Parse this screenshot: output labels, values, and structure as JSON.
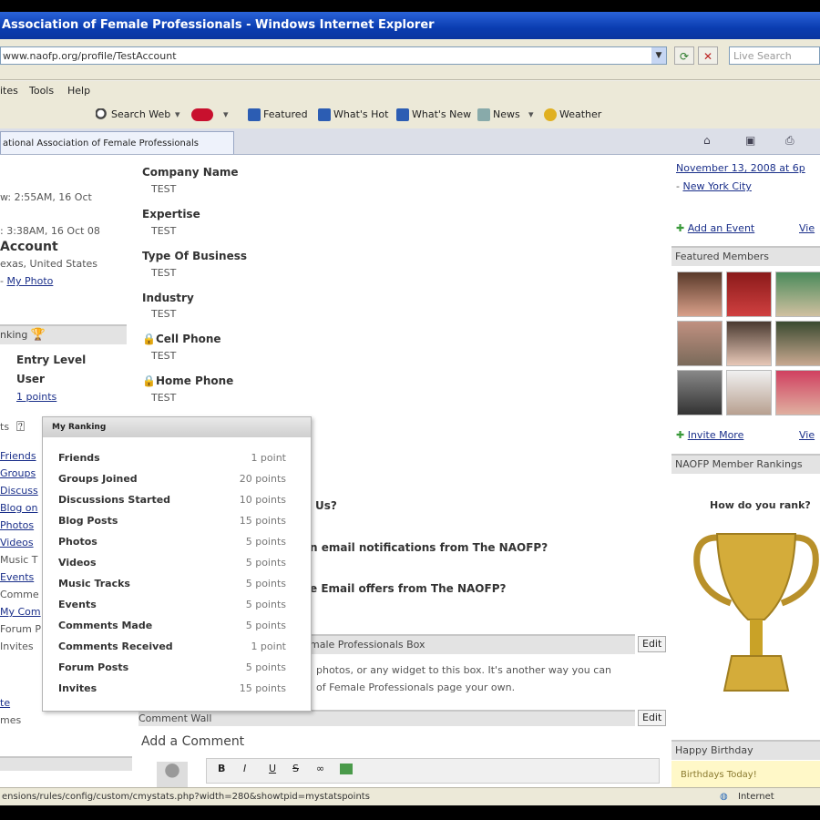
{
  "window": {
    "title": "Association of Female Professionals - Windows Internet Explorer"
  },
  "address": {
    "url": "www.naofp.org/profile/TestAccount",
    "search_placeholder": "Live Search"
  },
  "menu": {
    "items": [
      "ites",
      "Tools",
      "Help"
    ]
  },
  "toolbar": {
    "search_web": "Search Web",
    "featured": "Featured",
    "whats_hot": "What's Hot",
    "whats_new": "What's New",
    "news": "News",
    "weather": "Weather"
  },
  "tab": {
    "label": "ational Association of Female Professionals"
  },
  "left": {
    "last_seen_1": "w: 2:55AM, 16 Oct",
    "last_seen_2": ": 3:38AM, 16 Oct 08",
    "name": "Account",
    "location": "exas, United States",
    "my_photo_prefix": "-",
    "my_photo": "My Photo",
    "ranking_header": "nking",
    "entry_level": "Entry Level",
    "user": "User",
    "points": "1 points",
    "stats_label": "ts",
    "links": [
      "Friends",
      "Groups",
      "Discuss",
      "Blog on",
      "Photos",
      "Videos",
      "Music T",
      "Events",
      "Comme",
      "My Com",
      "Forum P",
      "Invites"
    ],
    "bottom_link": "te",
    "bottom_label": "mes"
  },
  "profile": {
    "fields": [
      {
        "label": "Company Name",
        "value": "TEST"
      },
      {
        "label": "Expertise",
        "value": "TEST"
      },
      {
        "label": "Type Of Business",
        "value": "TEST"
      },
      {
        "label": "Industry",
        "value": "TEST"
      },
      {
        "label": "Cell Phone",
        "value": "TEST"
      },
      {
        "label": "Home Phone",
        "value": "TEST"
      }
    ],
    "q1": "Us?",
    "q2": "n email notifications from The NAOFP?",
    "q3": "e Email offers from The NAOFP?",
    "box_title": "male Professionals Box",
    "box_edit": "Edit",
    "box_text_1": "photos, or any widget to this box. It's another way you can",
    "box_text_2": "of Female Professionals page your own.",
    "comment_wall": "Comment Wall",
    "comment_edit": "Edit",
    "add_comment": "Add a Comment"
  },
  "popup": {
    "title": "My Ranking",
    "rows": [
      {
        "label": "Friends",
        "points": "1 point"
      },
      {
        "label": "Groups Joined",
        "points": "20 points"
      },
      {
        "label": "Discussions Started",
        "points": "10 points"
      },
      {
        "label": "Blog Posts",
        "points": "15 points"
      },
      {
        "label": "Photos",
        "points": "5 points"
      },
      {
        "label": "Videos",
        "points": "5 points"
      },
      {
        "label": "Music Tracks",
        "points": "5 points"
      },
      {
        "label": "Events",
        "points": "5 points"
      },
      {
        "label": "Comments Made",
        "points": "5 points"
      },
      {
        "label": "Comments Received",
        "points": "1 point"
      },
      {
        "label": "Forum Posts",
        "points": "5 points"
      },
      {
        "label": "Invites",
        "points": "15 points"
      }
    ]
  },
  "right": {
    "event_date": "November 13, 2008 at 6p",
    "event_location": "New York City",
    "add_event": "Add an Event",
    "view_1": "Vie",
    "featured_members": "Featured Members",
    "invite_more": "Invite More",
    "view_2": "Vie",
    "rankings": "NAOFP Member Rankings",
    "how_rank": "How do you rank?",
    "happy_birthday": "Happy Birthday",
    "birthdays_today": "Birthdays Today!"
  },
  "status": {
    "url": "ensions/rules/config/custom/cmystats.php?width=280&showtpid=mystatspoints",
    "zone": "Internet"
  },
  "colors": {
    "ie_blue": "#0a3cb0",
    "link": "#1a2f8a",
    "trophy_gold": "#c9a227"
  }
}
